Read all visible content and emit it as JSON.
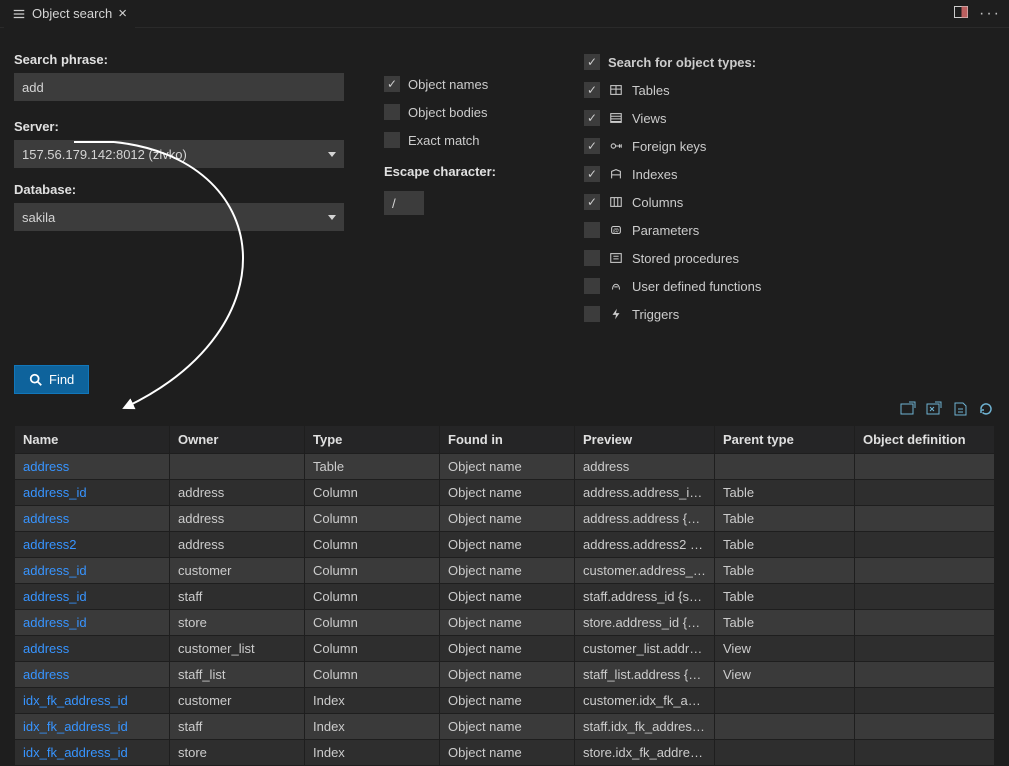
{
  "tab": {
    "title": "Object search"
  },
  "labels": {
    "search_phrase": "Search phrase:",
    "server": "Server:",
    "database": "Database:",
    "escape_character": "Escape character:",
    "find": "Find"
  },
  "inputs": {
    "search_phrase": "add",
    "server": "157.56.179.142:8012 (zivko)",
    "database": "sakila",
    "escape_character": "/"
  },
  "mid_checks": {
    "object_names": {
      "label": "Object names",
      "checked": true
    },
    "object_bodies": {
      "label": "Object bodies",
      "checked": false
    },
    "exact_match": {
      "label": "Exact match",
      "checked": false
    }
  },
  "types_header": "Search for object types:",
  "types": [
    {
      "label": "Tables",
      "checked": true,
      "icon": "table"
    },
    {
      "label": "Views",
      "checked": true,
      "icon": "view"
    },
    {
      "label": "Foreign keys",
      "checked": true,
      "icon": "fk"
    },
    {
      "label": "Indexes",
      "checked": true,
      "icon": "index"
    },
    {
      "label": "Columns",
      "checked": true,
      "icon": "column"
    },
    {
      "label": "Parameters",
      "checked": false,
      "icon": "param"
    },
    {
      "label": "Stored procedures",
      "checked": false,
      "icon": "sp"
    },
    {
      "label": "User defined functions",
      "checked": false,
      "icon": "udf"
    },
    {
      "label": "Triggers",
      "checked": false,
      "icon": "trigger"
    }
  ],
  "columns": [
    "Name",
    "Owner",
    "Type",
    "Found in",
    "Preview",
    "Parent type",
    "Object definition"
  ],
  "rows": [
    {
      "name": "address",
      "owner": "",
      "type": "Table",
      "found": "Object name",
      "preview": "address",
      "parent": "",
      "def": ""
    },
    {
      "name": "address_id",
      "owner": "address",
      "type": "Column",
      "found": "Object name",
      "preview": "address.address_i…",
      "parent": "Table",
      "def": ""
    },
    {
      "name": "address",
      "owner": "address",
      "type": "Column",
      "found": "Object name",
      "preview": "address.address {v…",
      "parent": "Table",
      "def": ""
    },
    {
      "name": "address2",
      "owner": "address",
      "type": "Column",
      "found": "Object name",
      "preview": "address.address2 {…",
      "parent": "Table",
      "def": ""
    },
    {
      "name": "address_id",
      "owner": "customer",
      "type": "Column",
      "found": "Object name",
      "preview": "customer.address_…",
      "parent": "Table",
      "def": ""
    },
    {
      "name": "address_id",
      "owner": "staff",
      "type": "Column",
      "found": "Object name",
      "preview": "staff.address_id {s…",
      "parent": "Table",
      "def": ""
    },
    {
      "name": "address_id",
      "owner": "store",
      "type": "Column",
      "found": "Object name",
      "preview": "store.address_id {s…",
      "parent": "Table",
      "def": ""
    },
    {
      "name": "address",
      "owner": "customer_list",
      "type": "Column",
      "found": "Object name",
      "preview": "customer_list.addr…",
      "parent": "View",
      "def": ""
    },
    {
      "name": "address",
      "owner": "staff_list",
      "type": "Column",
      "found": "Object name",
      "preview": "staff_list.address {…",
      "parent": "View",
      "def": ""
    },
    {
      "name": "idx_fk_address_id",
      "owner": "customer",
      "type": "Index",
      "found": "Object name",
      "preview": "customer.idx_fk_a…",
      "parent": "",
      "def": ""
    },
    {
      "name": "idx_fk_address_id",
      "owner": "staff",
      "type": "Index",
      "found": "Object name",
      "preview": "staff.idx_fk_addres…",
      "parent": "",
      "def": ""
    },
    {
      "name": "idx_fk_address_id",
      "owner": "store",
      "type": "Index",
      "found": "Object name",
      "preview": "store.idx_fk_addre…",
      "parent": "",
      "def": ""
    }
  ]
}
